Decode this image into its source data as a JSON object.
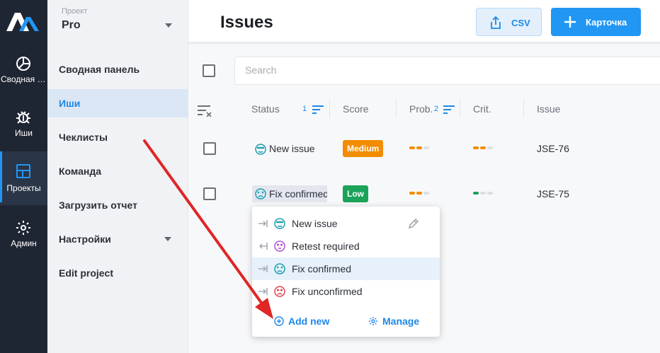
{
  "rail": {
    "items": [
      {
        "label": "Сводная панель",
        "icon": "dashboard-icon"
      },
      {
        "label": "Иши",
        "icon": "bug-icon"
      },
      {
        "label": "Проекты",
        "icon": "projects-icon"
      },
      {
        "label": "Админ",
        "icon": "gear-icon"
      }
    ]
  },
  "sidebar": {
    "caption": "Проект",
    "project": "Pro",
    "items": [
      {
        "label": "Сводная панель"
      },
      {
        "label": "Иши"
      },
      {
        "label": "Чеклисты"
      },
      {
        "label": "Команда"
      },
      {
        "label": "Загрузить отчет"
      },
      {
        "label": "Настройки"
      },
      {
        "label": "Edit project"
      }
    ]
  },
  "header": {
    "title": "Issues",
    "csv_label": "CSV",
    "card_label": "Карточка"
  },
  "search": {
    "placeholder": "Search"
  },
  "columns": {
    "status": "Status",
    "status_sort": "1",
    "score": "Score",
    "prob": "Prob.",
    "prob_sort": "2",
    "crit": "Crit.",
    "issue": "Issue"
  },
  "rows": [
    {
      "status": "New issue",
      "score": "Medium",
      "issue": "JSE-76"
    },
    {
      "status": "Fix confirmed",
      "score": "Low",
      "issue": "JSE-75"
    }
  ],
  "dropdown": {
    "options": [
      {
        "label": "New issue"
      },
      {
        "label": "Retest required"
      },
      {
        "label": "Fix confirmed"
      },
      {
        "label": "Fix unconfirmed"
      }
    ],
    "add_new": "Add new",
    "manage": "Manage"
  },
  "colors": {
    "accent": "#2196f3",
    "medium_badge": "#f28c00",
    "low_badge": "#1ba35a",
    "rail_bg": "#1f2633",
    "annotation_arrow": "#e02626"
  }
}
